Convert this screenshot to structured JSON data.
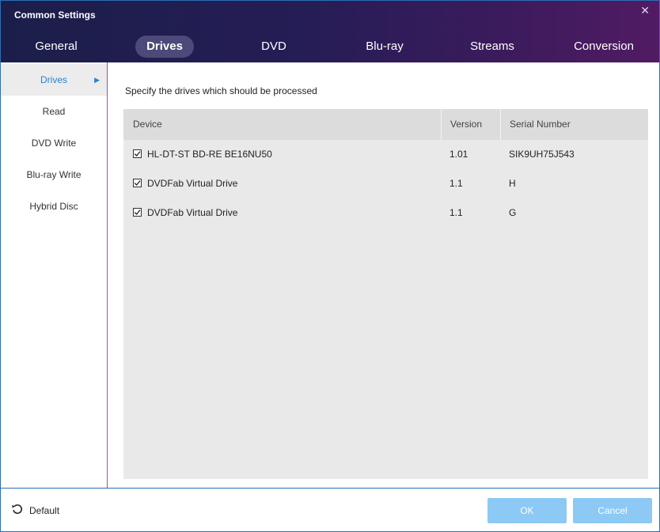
{
  "window": {
    "title": "Common Settings"
  },
  "tabs": [
    {
      "label": "General"
    },
    {
      "label": "Drives"
    },
    {
      "label": "DVD"
    },
    {
      "label": "Blu-ray"
    },
    {
      "label": "Streams"
    },
    {
      "label": "Conversion"
    }
  ],
  "active_tab": "Drives",
  "sidebar": {
    "items": [
      {
        "label": "Drives"
      },
      {
        "label": "Read"
      },
      {
        "label": "DVD Write"
      },
      {
        "label": "Blu-ray Write"
      },
      {
        "label": "Hybrid Disc"
      }
    ],
    "active": "Drives"
  },
  "main": {
    "instruction": "Specify the drives which should be processed",
    "columns": [
      "Device",
      "Version",
      "Serial Number"
    ],
    "rows": [
      {
        "device": "HL-DT-ST BD-RE  BE16NU50",
        "version": "1.01",
        "serial": "SIK9UH75J543",
        "checked": true
      },
      {
        "device": "DVDFab Virtual Drive",
        "version": "1.1",
        "serial": "H",
        "checked": true
      },
      {
        "device": "DVDFab Virtual Drive",
        "version": "1.1",
        "serial": "G",
        "checked": true
      }
    ]
  },
  "footer": {
    "default_label": "Default",
    "ok_label": "OK",
    "cancel_label": "Cancel"
  },
  "colors": {
    "accent": "#2a7fd4",
    "button_disabled": "#8cc9f4",
    "header_start": "#1b1e4a",
    "header_end": "#511b63"
  }
}
